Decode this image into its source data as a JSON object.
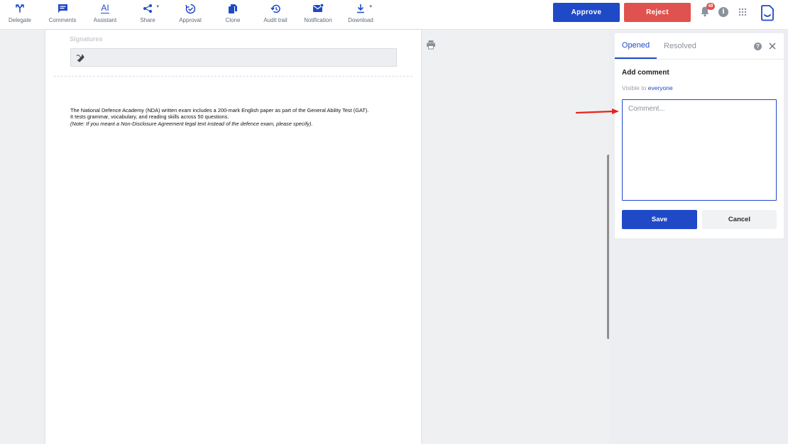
{
  "toolbar": {
    "tools": [
      {
        "label": "Delegate",
        "icon": "delegate-icon"
      },
      {
        "label": "Comments",
        "icon": "comments-icon"
      },
      {
        "label": "Assistant",
        "icon": "ai-assistant-icon"
      },
      {
        "label": "Share",
        "icon": "share-icon"
      },
      {
        "label": "Approval",
        "icon": "approval-icon"
      },
      {
        "label": "Clone",
        "icon": "clone-icon"
      },
      {
        "label": "Audit trail",
        "icon": "history-icon"
      },
      {
        "label": "Notification",
        "icon": "mail-notification-icon"
      },
      {
        "label": "Download",
        "icon": "download-icon"
      }
    ],
    "ai_glyph": "AI",
    "approve_label": "Approve",
    "reject_label": "Reject",
    "notification_count": "49",
    "info_glyph": "i"
  },
  "document": {
    "signatures_label": "Signatures",
    "line1": "The National Defence Academy (NDA) written exam includes a 200-mark English paper as part of the General Ability Test (GAT).",
    "line2": "It tests grammar, vocabulary, and reading skills across 50 questions.",
    "note": "(Note: If you meant a Non-Disclosure Agreement legal text instead of the defence exam, please specify)."
  },
  "comments_panel": {
    "tab_opened": "Opened",
    "tab_resolved": "Resolved",
    "help_glyph": "?",
    "title": "Add comment",
    "visible_prefix": "Visible to",
    "visible_link": "everyone",
    "placeholder": "Comment...",
    "save_label": "Save",
    "cancel_label": "Cancel"
  },
  "colors": {
    "primary": "#1f49c7",
    "danger": "#e0524f",
    "annotation_arrow": "#e8231b"
  }
}
